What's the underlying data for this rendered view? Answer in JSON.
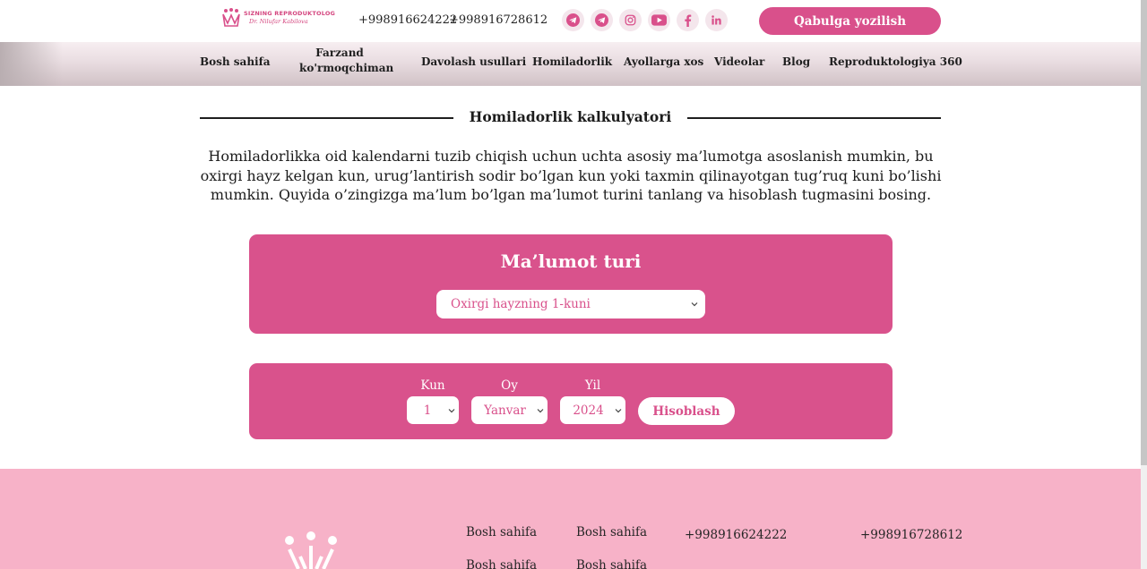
{
  "header": {
    "logo_line1": "SIZNING REPRODUKTOLOG",
    "logo_line2": "Dr. Nilufar Kabilova",
    "phone1": "+998916624222",
    "phone2": "+998916728612",
    "socials": [
      {
        "name": "telegram-icon"
      },
      {
        "name": "telegram-icon"
      },
      {
        "name": "instagram-icon"
      },
      {
        "name": "youtube-icon"
      },
      {
        "name": "facebook-icon"
      },
      {
        "name": "linkedin-icon"
      }
    ],
    "cta_label": "Qabulga yozilish"
  },
  "nav": {
    "items": [
      "Bosh sahifa",
      "Farzand",
      "ko'rmoqchiman",
      "Davolash usullari",
      "Homiladorlik",
      "Ayollarga xos",
      "Videolar",
      "Blog",
      "Reproduktologiya 360"
    ]
  },
  "main": {
    "title": "Homiladorlik kalkulyatori",
    "intro": "Homiladorlikka oid kalendarni tuzib chiqish uchun uchta asosiy ma’lumotga asoslanish mumkin, bu oxirgi hayz kelgan kun, urug’lantirish sodir bo’lgan kun yoki taxmin qilinayotgan tug’ruq kuni bo’lishi mumkin. Quyida o’zingizga ma’lum bo’lgan ma’lumot turini tanlang va hisoblash tugmasini bosing.",
    "type_card": {
      "title": "Ma’lumot turi",
      "selected": "Oxirgi hayzning 1-kuni"
    },
    "date_card": {
      "day_label": "Kun",
      "day_value": "1",
      "month_label": "Oy",
      "month_value": "Yanvar",
      "year_label": "Yil",
      "year_value": "2024",
      "button_label": "Hisoblash"
    }
  },
  "footer": {
    "col1": [
      "Bosh sahifa",
      "Bosh sahifa"
    ],
    "col2": [
      "Bosh sahifa",
      "Bosh sahifa"
    ],
    "phone1": "+998916624222",
    "phone2": "+998916728612"
  },
  "colors": {
    "accent": "#d9528c",
    "footer_bg": "#f7b2c8",
    "nav_bg": "#e9dde1"
  }
}
